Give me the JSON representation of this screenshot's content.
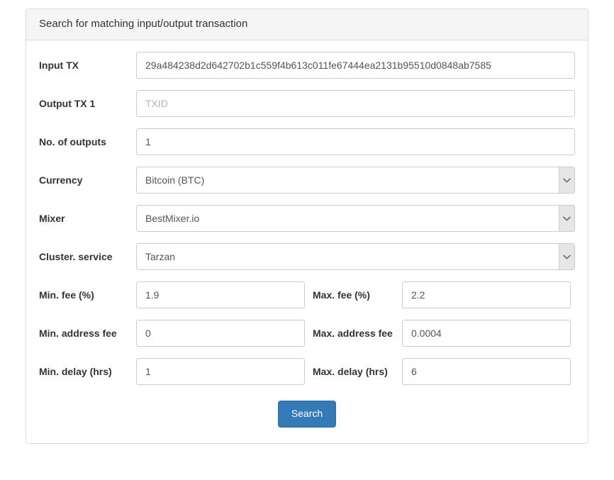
{
  "panel": {
    "heading": "Search for matching input/output transaction"
  },
  "form": {
    "input_tx": {
      "label": "Input TX",
      "value": "29a484238d2d642702b1c559f4b613c011fe67444ea2131b95510d0848ab7585",
      "placeholder": "TXID"
    },
    "output_tx_1": {
      "label": "Output TX 1",
      "value": "",
      "placeholder": "TXID"
    },
    "no_of_outputs": {
      "label": "No. of outputs",
      "value": "1",
      "placeholder": ""
    },
    "currency": {
      "label": "Currency",
      "value": "Bitcoin (BTC)"
    },
    "mixer": {
      "label": "Mixer",
      "value": "BestMixer.io"
    },
    "cluster_service": {
      "label": "Cluster. service",
      "value": "Tarzan"
    },
    "min_fee": {
      "label": "Min. fee (%)",
      "value": "1.9",
      "placeholder": ""
    },
    "max_fee": {
      "label": "Max. fee (%)",
      "value": "2.2",
      "placeholder": ""
    },
    "min_address_fee": {
      "label": "Min. address fee",
      "value": "0",
      "placeholder": ""
    },
    "max_address_fee": {
      "label": "Max. address fee",
      "value": "0.0004",
      "placeholder": ""
    },
    "min_delay": {
      "label": "Min. delay (hrs)",
      "value": "1",
      "placeholder": ""
    },
    "max_delay": {
      "label": "Max. delay (hrs)",
      "value": "6",
      "placeholder": ""
    }
  },
  "actions": {
    "search_label": "Search"
  },
  "icons": {
    "chevron_down": "chevron-down-icon"
  },
  "colors": {
    "primary": "#337ab7",
    "primary_border": "#2e6da4",
    "panel_border": "#dddddd",
    "panel_heading_bg": "#f5f5f5",
    "input_border": "#cccccc",
    "select_arrow_bg": "#e6e6e6"
  }
}
